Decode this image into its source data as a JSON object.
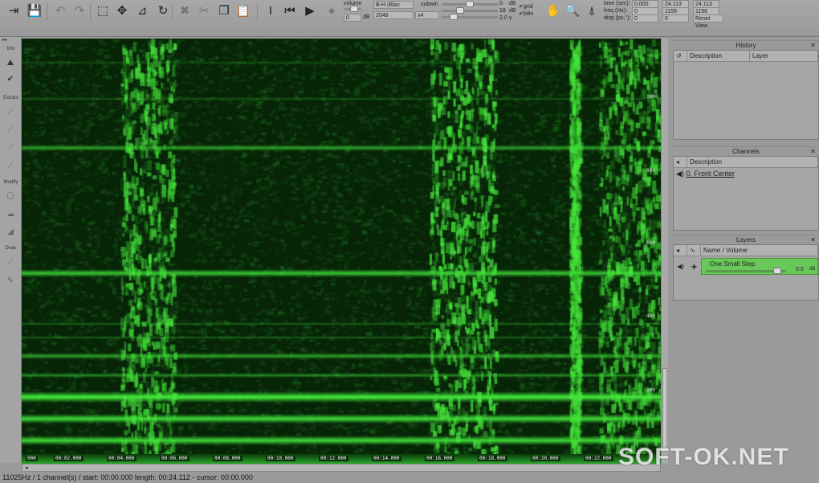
{
  "toolbar": {
    "icons": [
      "import-icon",
      "save-icon",
      "undo-icon",
      "redo-icon",
      "select-icon",
      "move-icon",
      "resize-icon",
      "reset-icon",
      "cut-icon",
      "scissors-icon",
      "copy-icon",
      "paste-icon",
      "cursor-icon",
      "rewind-icon",
      "play-icon",
      "record-icon"
    ],
    "volume_label": "volume",
    "volume_value": "0",
    "volume_unit": "dB",
    "colormap": "B-H (Blac",
    "fft_size": "2048",
    "subwin_label": "subwin",
    "subwin_value": "x4",
    "gain1": "0",
    "gain1_unit": "dB",
    "gain2": "18",
    "gain2_unit": "dB",
    "gamma": "2.0",
    "gamma_unit": "γ",
    "grid_label": "grid",
    "bilin_label": "bilin",
    "time_label": "time (sec):",
    "time": [
      "0.000",
      "24.113",
      "24.113"
    ],
    "freq_label": "freq (Hz):",
    "freq": [
      "0",
      "1156",
      "1156"
    ],
    "disp_label": "disp (px,°):",
    "disp": [
      "0",
      "0"
    ],
    "reset_view": "Reset View"
  },
  "leftpanel": {
    "sections": [
      "Info",
      "Extract",
      "Modify",
      "Draw"
    ]
  },
  "spectrogram": {
    "y_ticks": [
      "1000",
      "800",
      "600",
      "400",
      "200"
    ],
    "x_ticks": [
      "000",
      "00:02.000",
      "00:04.000",
      "00:06.000",
      "00:08.000",
      "00:10.000",
      "00:12.000",
      "00:14.000",
      "00:16.000",
      "00:18.000",
      "00:20.000",
      "00:22.000"
    ],
    "color": "#39e639"
  },
  "status": "11025Hz / 1 channel(s) / start: 00:00.000 length:  00:24.112 - cursor:  00:00.000",
  "history": {
    "title": "History",
    "cols": [
      "Description",
      "Layer"
    ]
  },
  "channels": {
    "title": "Channels",
    "cols": [
      "Description"
    ],
    "items": [
      "0. Front Center"
    ]
  },
  "layers": {
    "title": "Layers",
    "cols": [
      "Name / Volume"
    ],
    "items": [
      {
        "name": "One Small Step",
        "volume": "0.0",
        "unit": "dB",
        "color": "#6ac85a"
      }
    ]
  },
  "watermark": "SOFT-OK.NET"
}
